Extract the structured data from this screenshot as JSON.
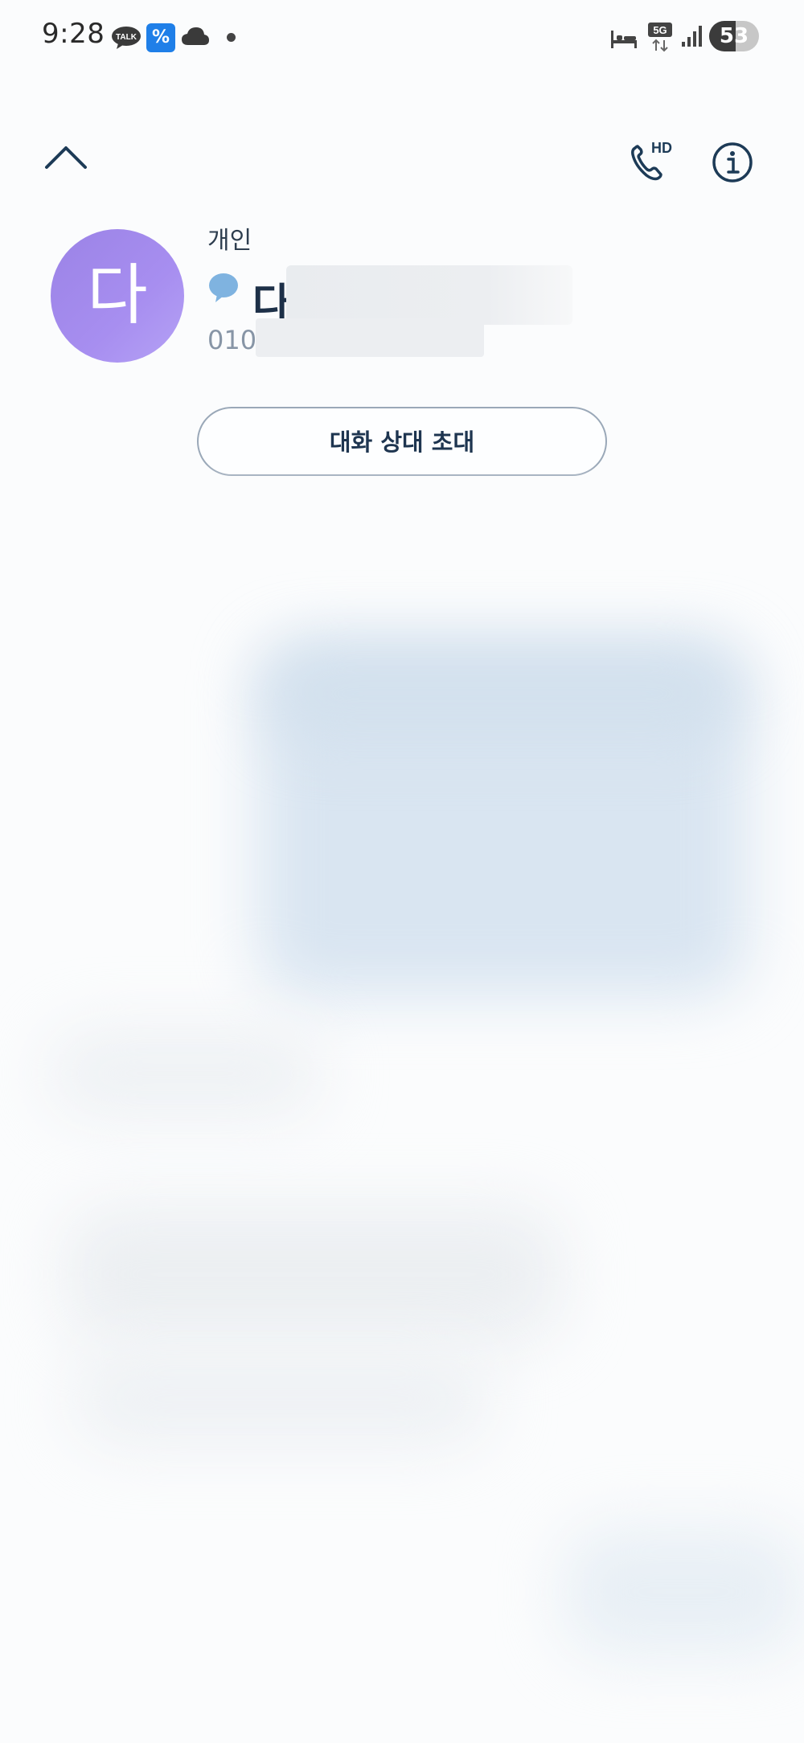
{
  "status_bar": {
    "time": "9:28",
    "notification_icons": [
      "kakaotalk-icon",
      "percent-app-icon",
      "cloud-icon",
      "dot-icon"
    ],
    "system_icons": [
      "sleep-mode-icon",
      "5g-icon",
      "signal-icon"
    ],
    "talk_badge": "TALK",
    "percent_glyph": "%",
    "network": "5G",
    "battery_level": "53",
    "battery_fraction": 0.53
  },
  "header": {
    "collapse_icon": "chevron-up-icon",
    "hd_call_label": "HD",
    "hd_call_icon": "phone-hd-icon",
    "info_icon": "info-icon"
  },
  "contact": {
    "avatar_letter": "다",
    "avatar_color": "#a48cec",
    "category": "개인",
    "name": "다",
    "phone_prefix": "010",
    "talk_icon": "kakaotalk-bubble-icon",
    "accent_color": "#1d3048"
  },
  "actions": {
    "invite_label": "대화 상대 초대"
  }
}
